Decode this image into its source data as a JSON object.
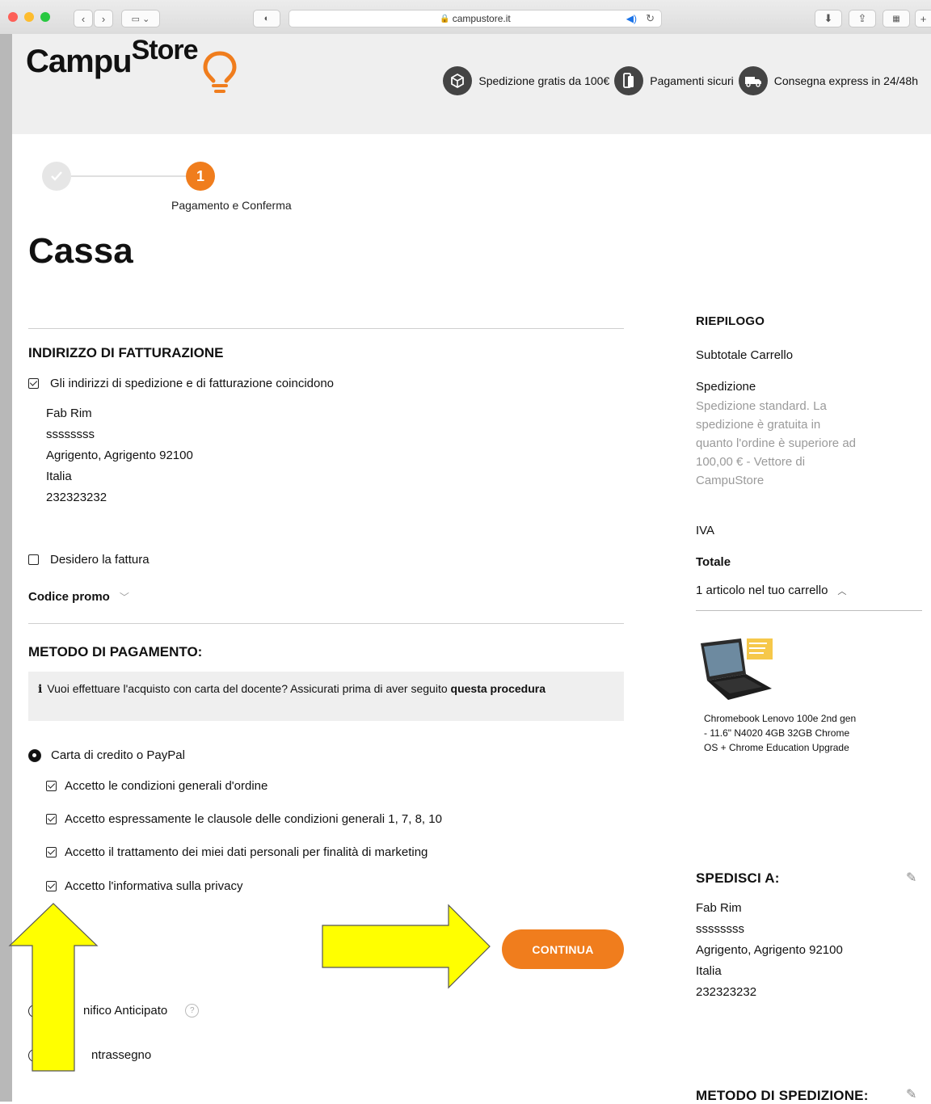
{
  "browser": {
    "url": "campustore.it"
  },
  "header": {
    "logo_text_main": "Campu",
    "logo_text_super": "Store",
    "features": [
      {
        "icon": "box-icon",
        "label": "Spedizione gratis da 100€"
      },
      {
        "icon": "card-icon",
        "label": "Pagamenti sicuri"
      },
      {
        "icon": "truck-icon",
        "label": "Consegna express in 24/48h"
      }
    ]
  },
  "steps": {
    "current_number": "1",
    "current_label": "Pagamento e Conferma"
  },
  "page_title": "Cassa",
  "billing": {
    "title": "INDIRIZZO DI FATTURAZIONE",
    "same_address_label": "Gli indirizzi di spedizione e di fatturazione coincidono",
    "same_address_checked": true,
    "address_lines": [
      "Fab Rim",
      "ssssssss",
      "Agrigento, Agrigento 92100",
      "Italia",
      "232323232"
    ],
    "invoice_label": "Desidero la fattura",
    "invoice_checked": false,
    "promo_label": "Codice promo"
  },
  "payment": {
    "title": "METODO DI PAGAMENTO:",
    "info_text": "Vuoi effettuare l'acquisto con carta del docente? Assicurati prima di aver seguito",
    "info_link": "questa procedura",
    "options": [
      {
        "label": "Carta di credito o PayPal",
        "selected": true
      },
      {
        "label": "nifico Anticipato",
        "selected": false
      },
      {
        "label": "ntrassegno",
        "selected": false
      }
    ],
    "consents": [
      {
        "label": "Accetto le condizioni generali d'ordine",
        "checked": true
      },
      {
        "label": "Accetto espressamente le clausole delle condizioni generali 1, 7, 8, 10",
        "checked": true
      },
      {
        "label": "Accetto il trattamento dei miei dati personali per finalità di marketing",
        "checked": true
      },
      {
        "label": "Accetto l'informativa sulla privacy",
        "checked": true
      }
    ],
    "continue_label": "CONTINUA"
  },
  "summary": {
    "title": "RIEPILOGO",
    "subtotal_label": "Subtotale Carrello",
    "shipping_label": "Spedizione",
    "shipping_note": "Spedizione standard. La spedizione è gratuita in quanto l'ordine è superiore ad 100,00 € - Vettore di CampuStore",
    "vat_label": "IVA",
    "total_label": "Totale",
    "cart_count_label": "1 articolo nel tuo carrello",
    "product_name": "Chromebook Lenovo 100e 2nd gen - 11.6\" N4020 4GB 32GB Chrome OS + Chrome Education Upgrade"
  },
  "ship_to": {
    "title": "SPEDISCI A:",
    "address_lines": [
      "Fab Rim",
      "ssssssss",
      "Agrigento, Agrigento 92100",
      "Italia",
      "232323232"
    ]
  },
  "ship_method": {
    "title": "METODO DI SPEDIZIONE:"
  },
  "colors": {
    "accent": "#f07d1d",
    "annotation_arrow": "#ffff00"
  }
}
